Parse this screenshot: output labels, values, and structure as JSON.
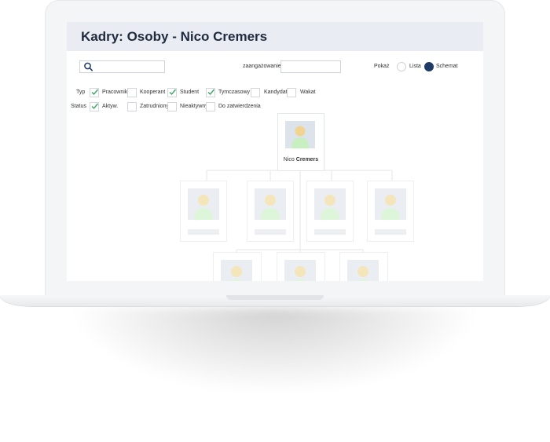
{
  "header": {
    "title": "Kadry: Osoby - Nico Cremers"
  },
  "toolbar": {
    "search_placeholder": "",
    "engagement_label": "zaangażowanie",
    "engagement_value": "",
    "show_label": "Pokaż",
    "view_options": [
      {
        "label": "Lista",
        "selected": false
      },
      {
        "label": "Schemat",
        "selected": true
      }
    ]
  },
  "filters": {
    "type_label": "Typ",
    "type_options": [
      {
        "label": "Pracownik",
        "checked": true
      },
      {
        "label": "Kooperant",
        "checked": false
      },
      {
        "label": "Student",
        "checked": true
      },
      {
        "label": "Tymczasowy",
        "checked": true
      },
      {
        "label": "Kandydat",
        "checked": false
      },
      {
        "label": "Wakat",
        "checked": false
      }
    ],
    "status_label": "Status",
    "status_options": [
      {
        "label": "Aktyw.",
        "checked": true
      },
      {
        "label": "Zatrudniony",
        "checked": false
      },
      {
        "label": "Nieaktywny",
        "checked": false
      },
      {
        "label": "Do zatwierdzenia",
        "checked": false
      }
    ]
  },
  "org_chart": {
    "root": {
      "first_name": "Nico",
      "last_name": "Cremers"
    }
  },
  "colors": {
    "header_bg": "#e9edf3",
    "accent": "#1f3a66",
    "check": "#3aa860",
    "avatar_head": "#f0d48f",
    "avatar_body": "#c8efc0",
    "avatar_bg": "#dde3ea"
  }
}
